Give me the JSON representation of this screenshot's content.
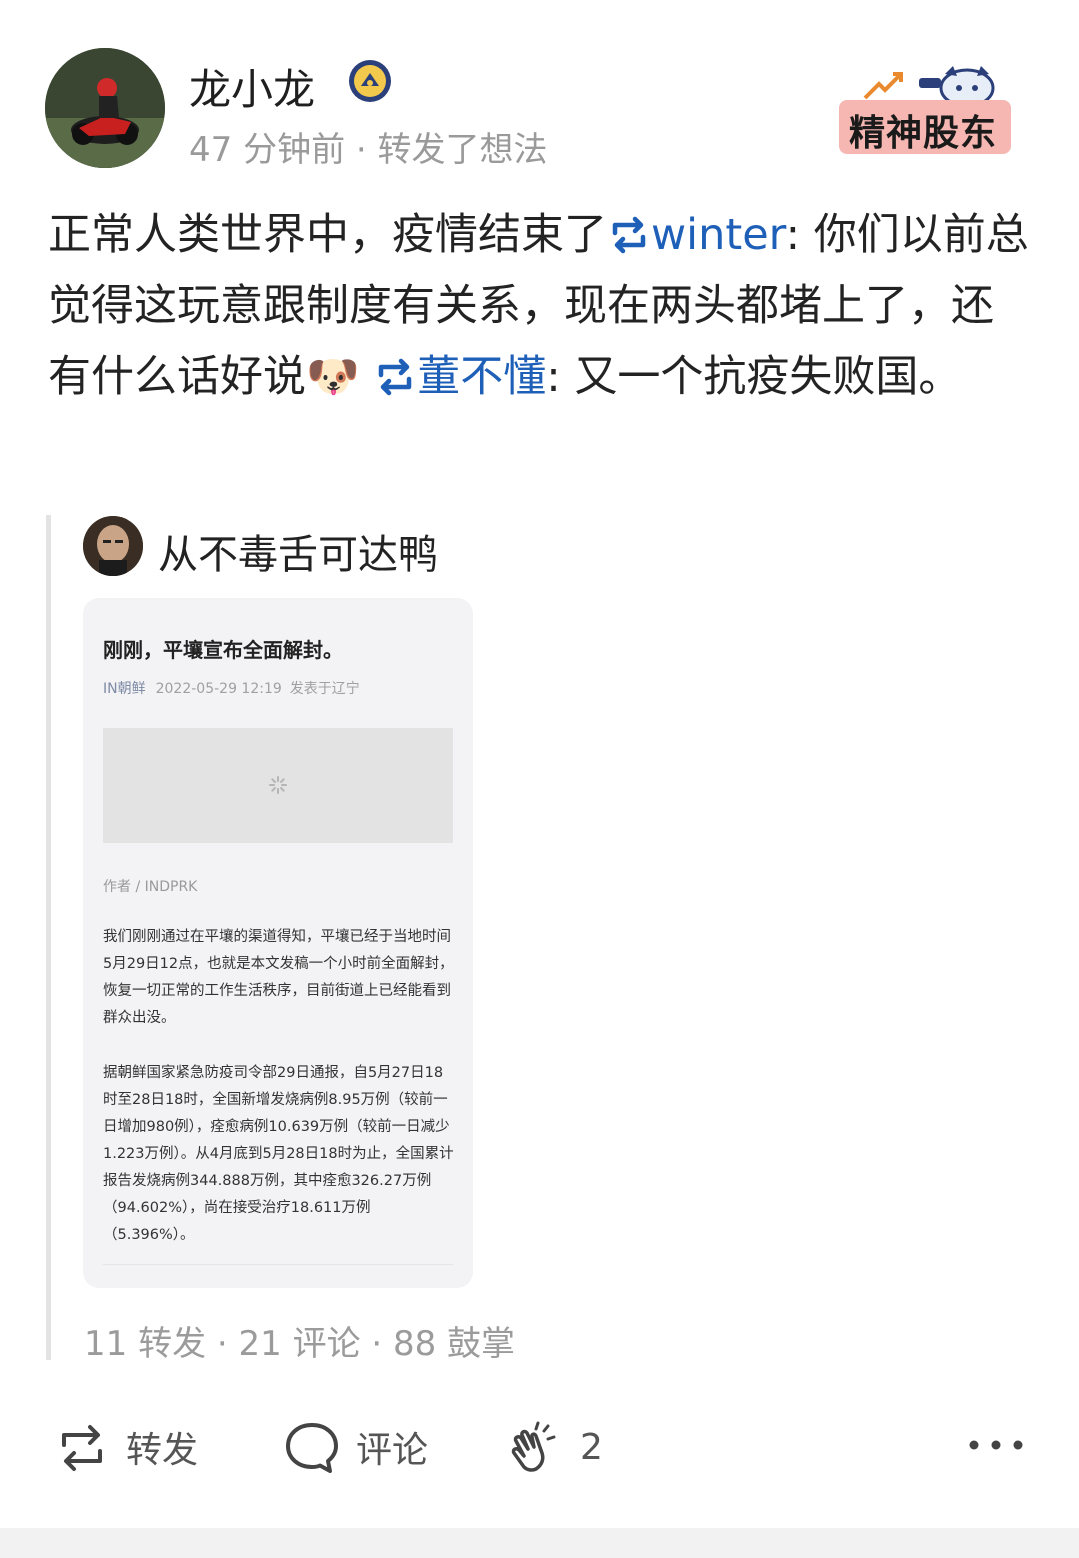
{
  "post": {
    "author": "龙小龙",
    "meta": "47 分钟前 · 转发了想法",
    "logo_text": "精神股东",
    "text_before": "正常人类世界中，疫情结束了",
    "mention1": "winter",
    "text_middle": ": 你们以前总觉得这玩意跟制度有关系，现在两头都堵上了，还有什么话好说",
    "emoji": "🐶",
    "mention2": "董不懂",
    "text_after": ": 又一个抗疫失败国。"
  },
  "quoted": {
    "author": "从不毒舌可达鸭",
    "card": {
      "title": "刚刚，平壤宣布全面解封。",
      "source": "IN朝鲜",
      "date": "2022-05-29 12:19",
      "location": "发表于辽宁",
      "byline": "作者 / INDPRK",
      "para1": "我们刚刚通过在平壤的渠道得知，平壤已经于当地时间5月29日12点，也就是本文发稿一个小时前全面解封，恢复一切正常的工作生活秩序，目前街道上已经能看到群众出没。",
      "para2": "据朝鲜国家紧急防疫司令部29日通报，自5月27日18时至28日18时，全国新增发烧病例8.95万例（较前一日增加980例），痊愈病例10.639万例（较前一日减少1.223万例）。从4月底到5月28日18时为止，全国累计报告发烧病例344.888万例，其中痊愈326.27万例（94.602%），尚在接受治疗18.611万例（5.396%）。"
    },
    "stats": "11 转发 · 21 评论 · 88 鼓掌"
  },
  "actions": {
    "repost": "转发",
    "comment": "评论",
    "clap_count": "2"
  }
}
